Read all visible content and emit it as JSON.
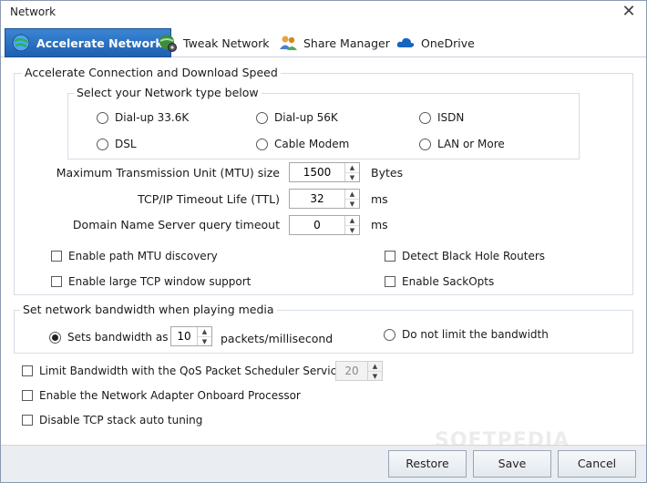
{
  "window": {
    "title": "Network",
    "close_glyph": "✕"
  },
  "tabs": [
    {
      "label": "Accelerate Network",
      "icon": "globe-icon",
      "active": true
    },
    {
      "label": "Tweak Network",
      "icon": "network-gear-icon",
      "active": false
    },
    {
      "label": "Share Manager",
      "icon": "users-icon",
      "active": false
    },
    {
      "label": "OneDrive",
      "icon": "cloud-icon",
      "active": false
    }
  ],
  "accelerate": {
    "title": "Accelerate Connection and Download Speed",
    "network_type": {
      "title": "Select your Network type below",
      "options": [
        "Dial-up 33.6K",
        "Dial-up 56K",
        "ISDN",
        "DSL",
        "Cable Modem",
        "LAN or More"
      ]
    },
    "mtu": {
      "label": "Maximum Transmission Unit (MTU) size",
      "value": "1500",
      "unit": "Bytes"
    },
    "ttl": {
      "label": "TCP/IP Timeout Life (TTL)",
      "value": "32",
      "unit": "ms"
    },
    "dns": {
      "label": "Domain Name Server query timeout",
      "value": "0",
      "unit": "ms"
    },
    "checks": {
      "path_mtu": "Enable path MTU discovery",
      "black_hole": "Detect Black Hole Routers",
      "large_tcp": "Enable large TCP window support",
      "sackopts": "Enable SackOpts"
    }
  },
  "bandwidth": {
    "title": "Set network bandwidth when playing media",
    "sets_label": "Sets bandwidth as",
    "sets_value": "10",
    "sets_unit": "packets/millisecond",
    "no_limit_label": "Do not limit the bandwidth"
  },
  "options": {
    "qos_label": "Limit Bandwidth with the QoS Packet Scheduler Service",
    "qos_value": "20",
    "adapter_label": "Enable the Network Adapter Onboard Processor",
    "autotune_label": "Disable TCP stack auto tuning"
  },
  "buttons": {
    "restore": "Restore",
    "save": "Save",
    "cancel": "Cancel"
  },
  "watermark": "SOFTPEDIA",
  "spinner_glyphs": {
    "up": "▲",
    "down": "▼"
  },
  "colors": {
    "tab_active": "#2a6fc2",
    "bottom_bar": "#eaedf1"
  }
}
